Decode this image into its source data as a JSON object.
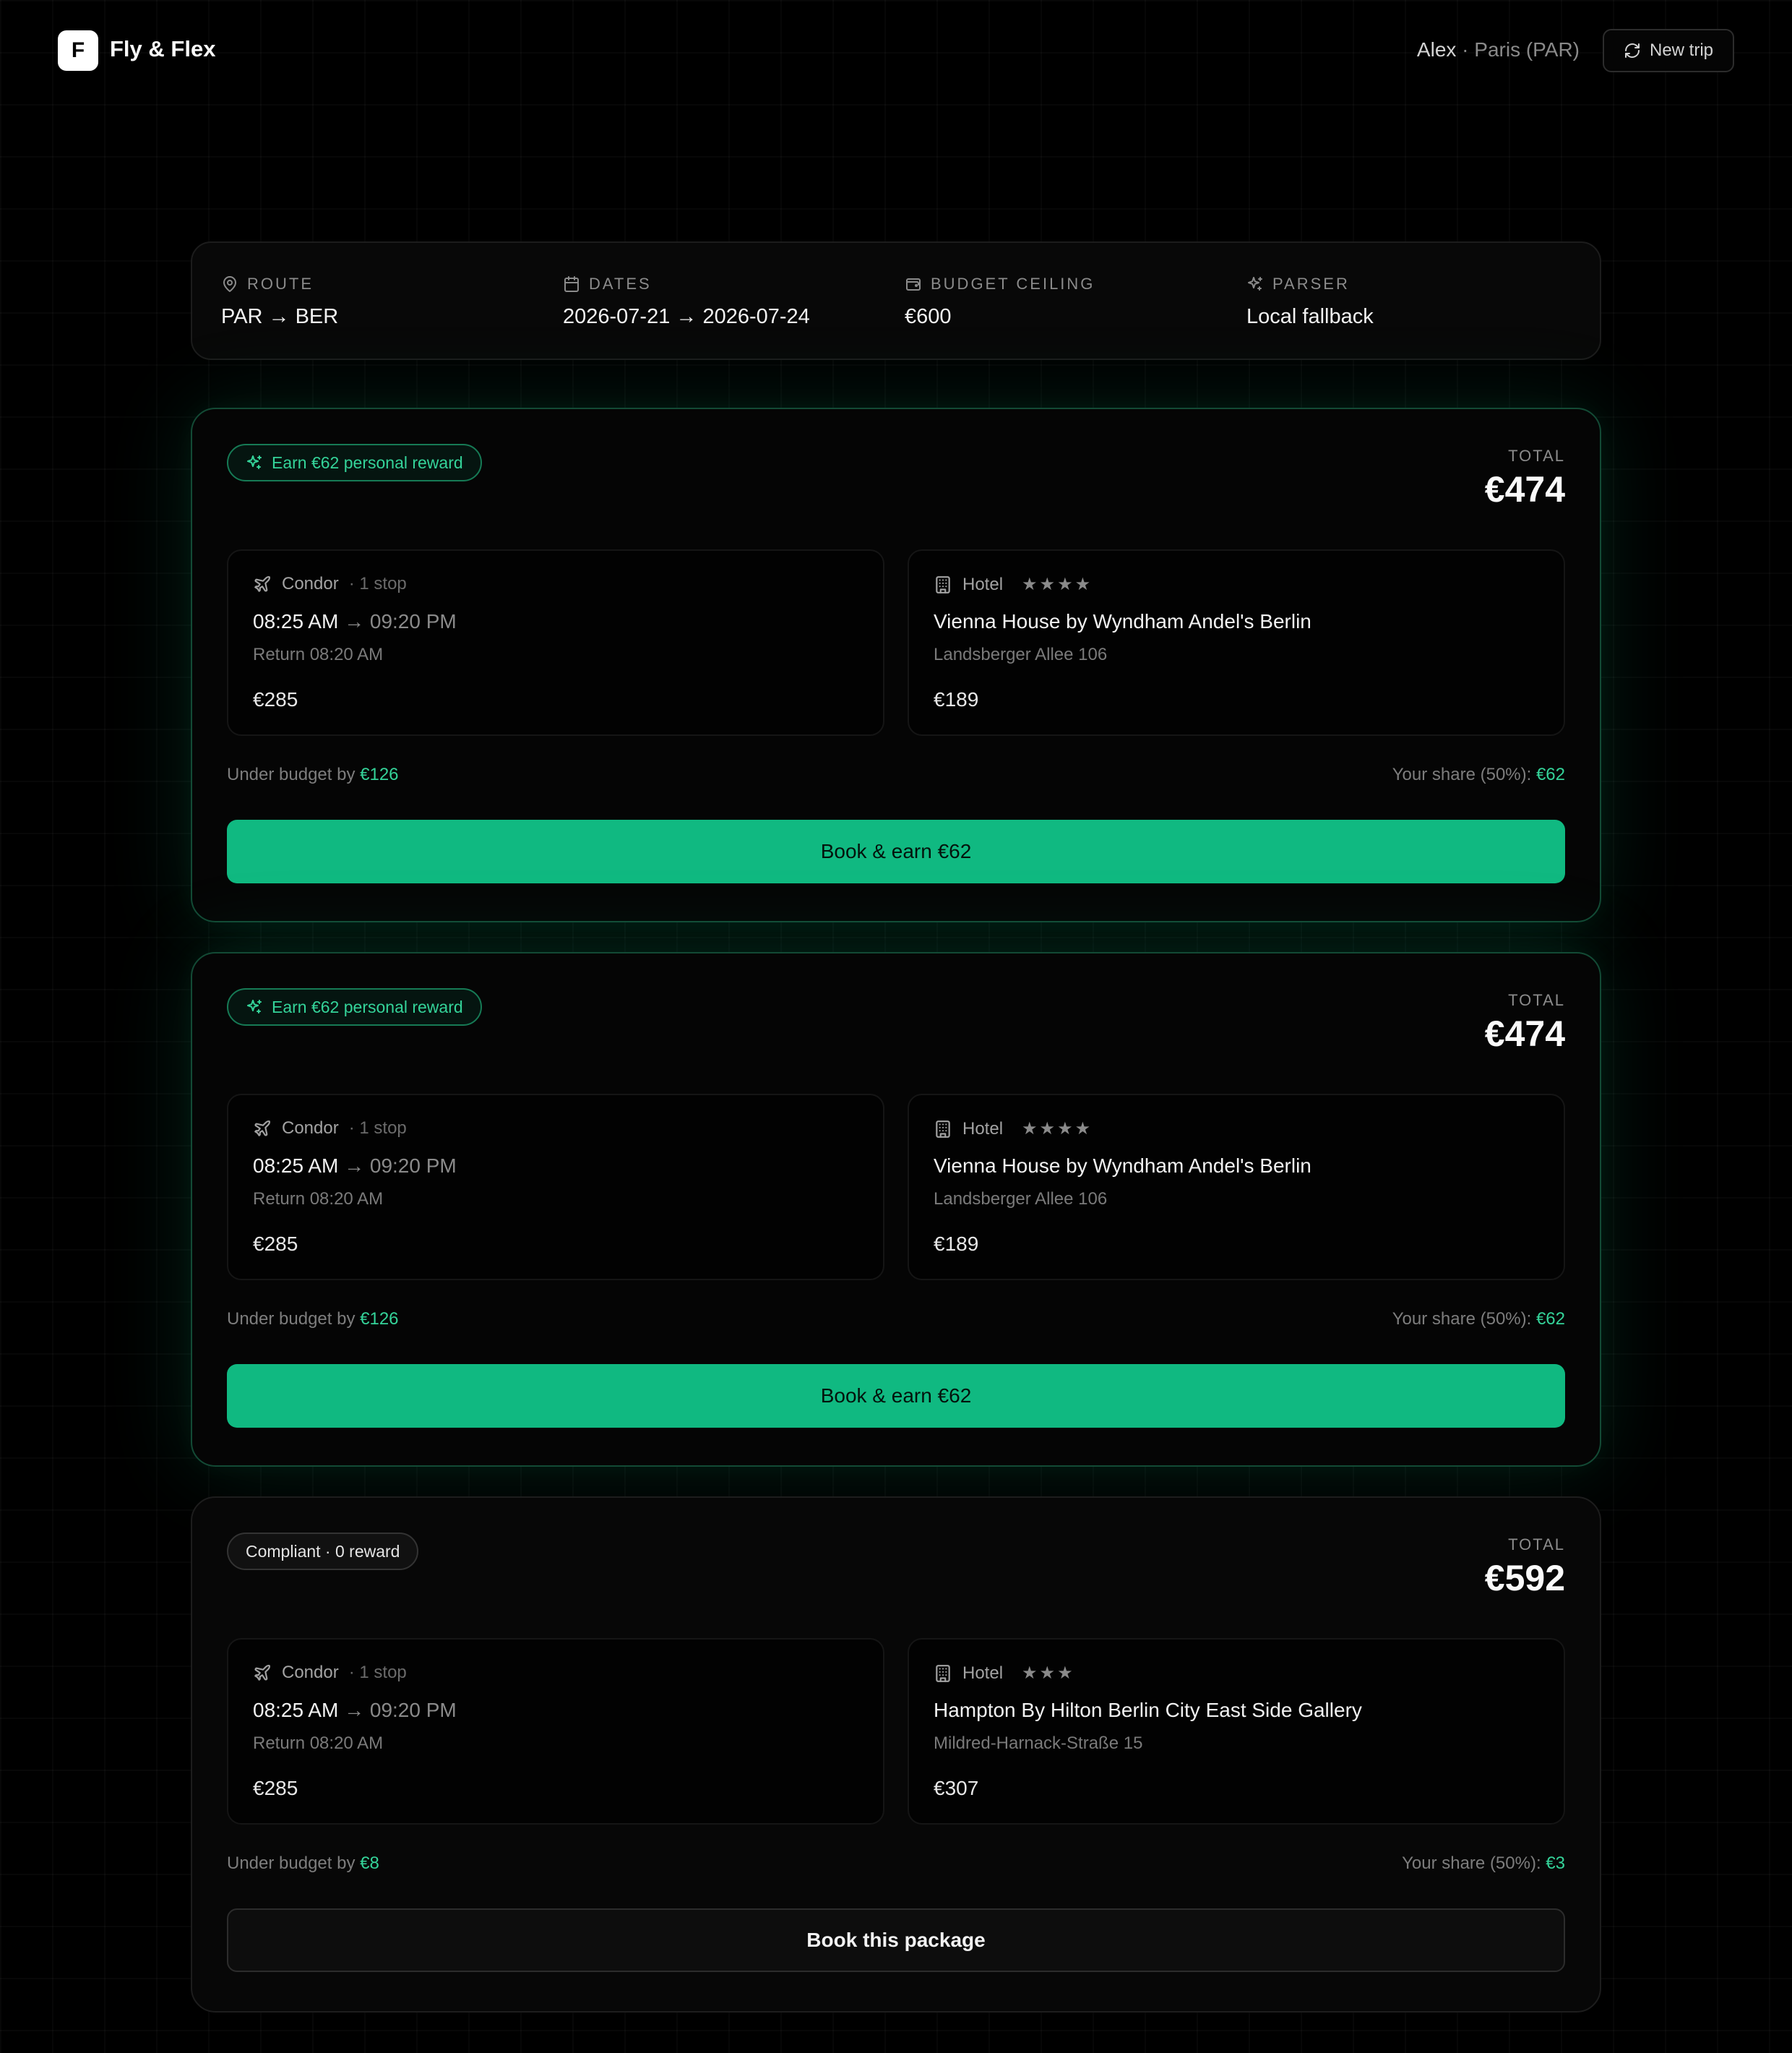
{
  "header": {
    "logo_letter": "F",
    "app_name": "Fly & Flex",
    "user_name": "Alex",
    "user_sep": " · ",
    "user_location": "Paris (PAR)",
    "new_trip_label": "New trip"
  },
  "summary": {
    "route_label": "ROUTE",
    "route_value": "PAR → BER",
    "dates_label": "DATES",
    "dates_value": "2026-07-21 → 2026-07-24",
    "budget_label": "BUDGET CEILING",
    "budget_value": "€600",
    "parser_label": "PARSER",
    "parser_value": "Local fallback"
  },
  "packages": [
    {
      "badge": "Earn €62 personal reward",
      "badge_style": "green",
      "total_label": "TOTAL",
      "total": "€474",
      "flight": {
        "airline": "Condor",
        "stops": "· 1 stop",
        "depart": "08:25 AM",
        "arrow": "→",
        "arrive": "09:20 PM",
        "return": "Return 08:20 AM",
        "price": "€285"
      },
      "hotel": {
        "label": "Hotel",
        "stars": 4,
        "name": "Vienna House by Wyndham Andel's Berlin",
        "address": "Landsberger Allee 106",
        "price": "€189"
      },
      "under_budget_text": "Under budget by ",
      "under_budget_value": "€126",
      "share_text": "Your share (50%): ",
      "share_value": "€62",
      "cta": "Book & earn €62"
    },
    {
      "badge": "Earn €62 personal reward",
      "badge_style": "green",
      "total_label": "TOTAL",
      "total": "€474",
      "flight": {
        "airline": "Condor",
        "stops": "· 1 stop",
        "depart": "08:25 AM",
        "arrow": "→",
        "arrive": "09:20 PM",
        "return": "Return 08:20 AM",
        "price": "€285"
      },
      "hotel": {
        "label": "Hotel",
        "stars": 4,
        "name": "Vienna House by Wyndham Andel's Berlin",
        "address": "Landsberger Allee 106",
        "price": "€189"
      },
      "under_budget_text": "Under budget by ",
      "under_budget_value": "€126",
      "share_text": "Your share (50%): ",
      "share_value": "€62",
      "cta": "Book & earn €62"
    },
    {
      "badge": "Compliant · 0 reward",
      "badge_style": "plain",
      "total_label": "TOTAL",
      "total": "€592",
      "flight": {
        "airline": "Condor",
        "stops": "· 1 stop",
        "depart": "08:25 AM",
        "arrow": "→",
        "arrive": "09:20 PM",
        "return": "Return 08:20 AM",
        "price": "€285"
      },
      "hotel": {
        "label": "Hotel",
        "stars": 3,
        "name": "Hampton By Hilton Berlin City East Side Gallery",
        "address": "Mildred-Harnack-Straße 15",
        "price": "€307"
      },
      "under_budget_text": "Under budget by ",
      "under_budget_value": "€8",
      "share_text": "Your share (50%): ",
      "share_value": "€3",
      "cta": "Book this package"
    }
  ],
  "icons": {
    "route": "map-pin-icon",
    "dates": "calendar-icon",
    "budget": "wallet-icon",
    "parser": "sparkles-icon",
    "flight": "plane-icon",
    "hotel": "building-icon",
    "refresh": "refresh-icon",
    "star": "star-icon"
  },
  "colors": {
    "accent": "#10b981",
    "accent_text": "#34d399",
    "background": "#000000"
  }
}
